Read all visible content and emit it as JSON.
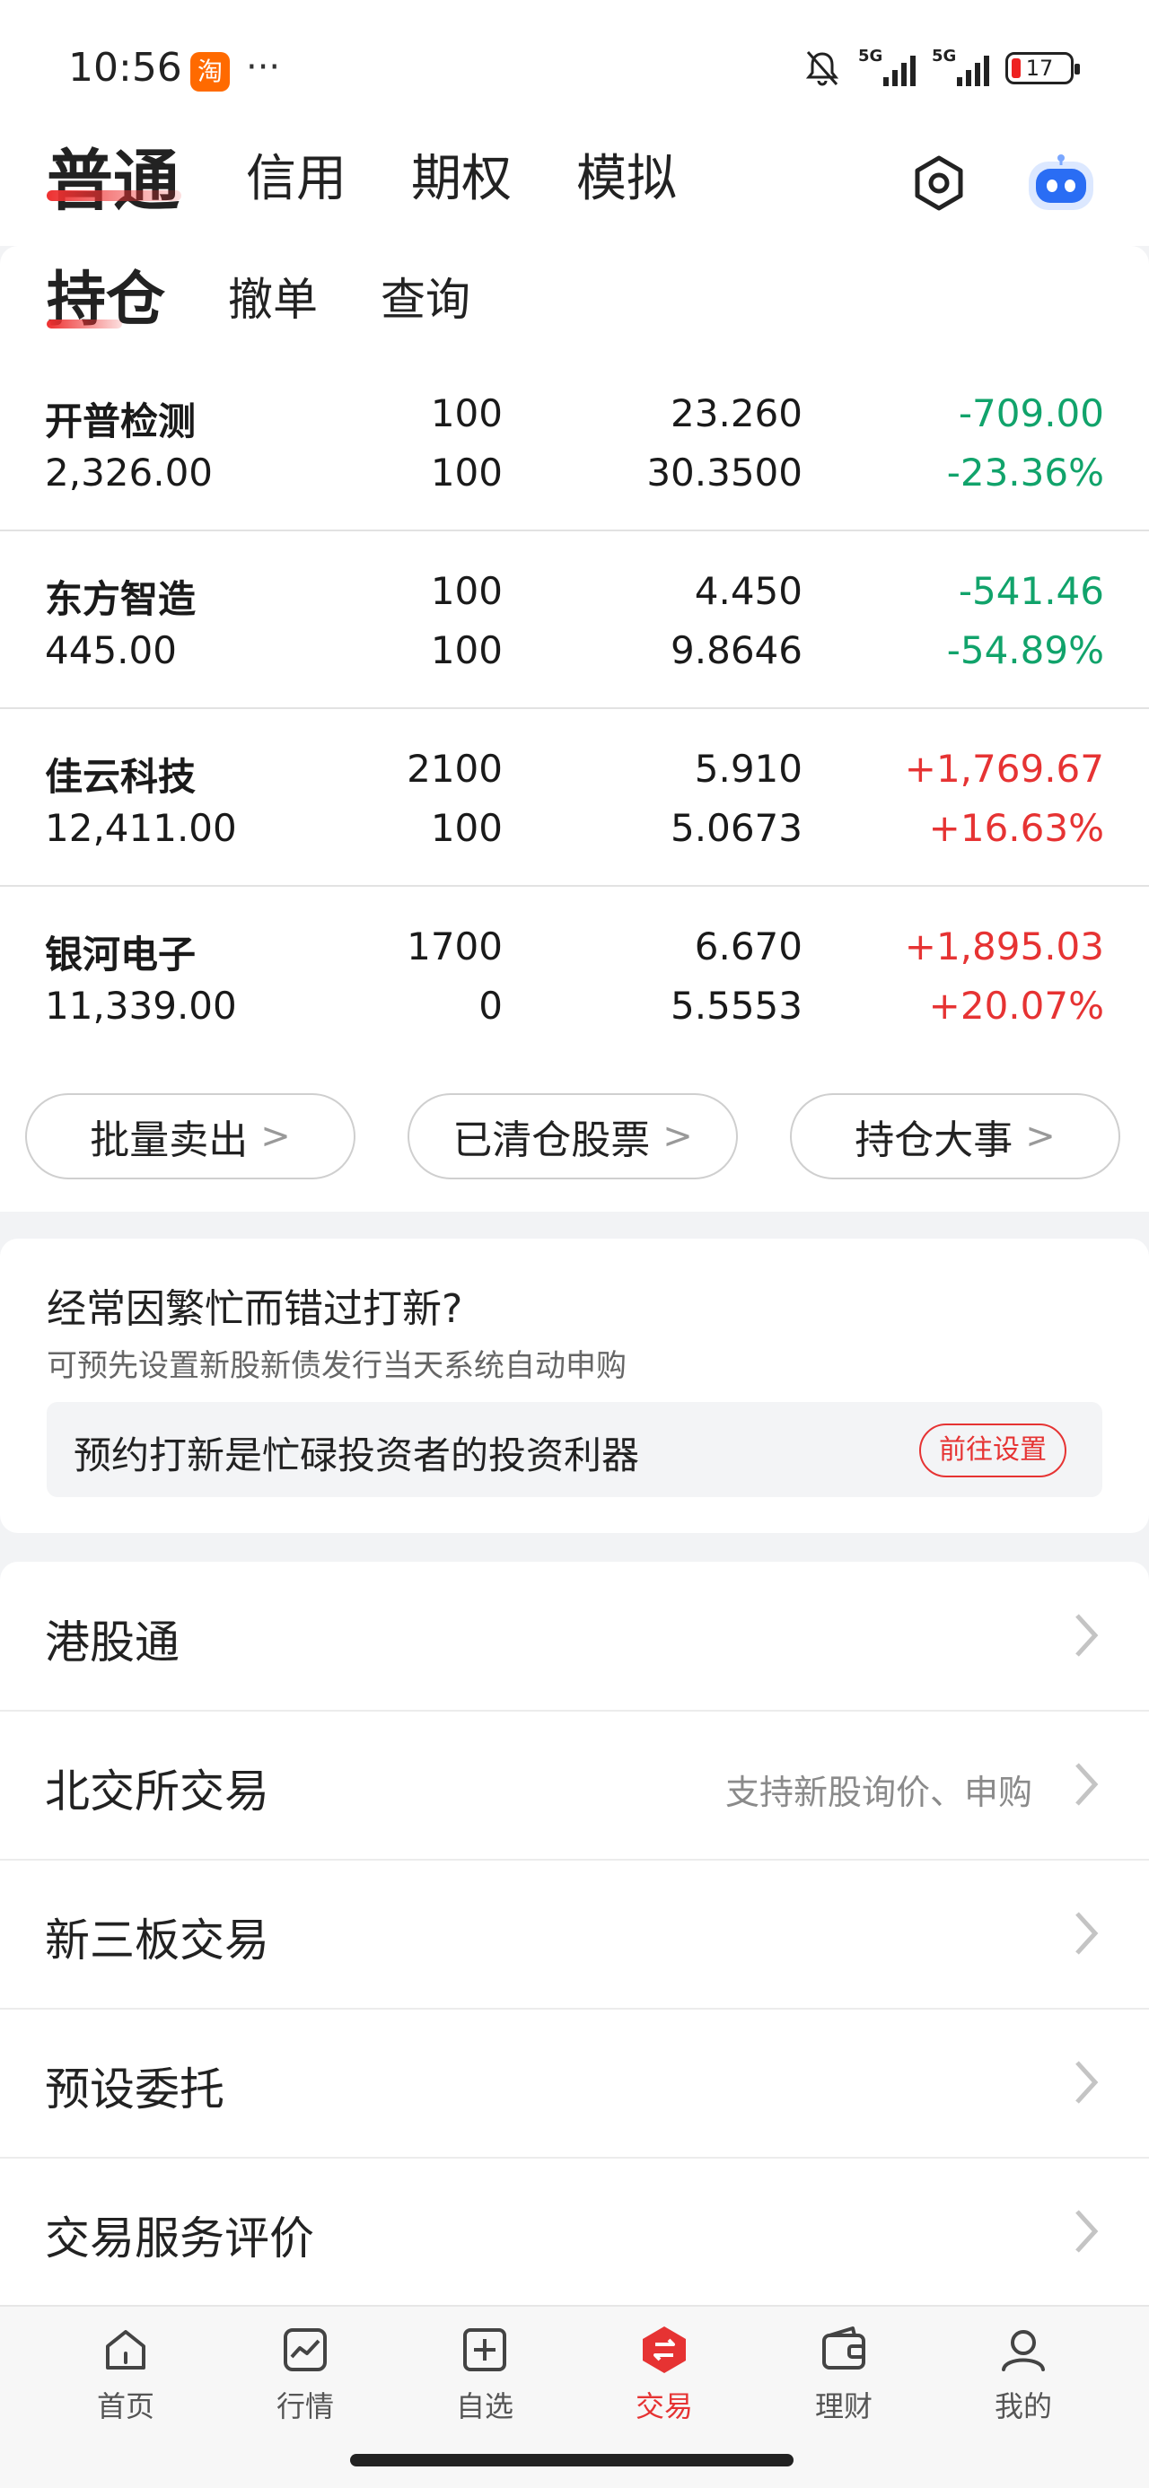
{
  "status_bar": {
    "time": "10:56",
    "app_badge": "淘",
    "more": "···",
    "signal_1": "5G",
    "signal_2": "5G",
    "battery": "17"
  },
  "top_tabs": [
    "普通",
    "信用",
    "期权",
    "模拟"
  ],
  "sub_tabs": [
    "持仓",
    "撤单",
    "查询"
  ],
  "holdings": [
    {
      "name": "开普检测",
      "market_value": "2,326.00",
      "qty": "100",
      "avail": "100",
      "price": "23.260",
      "cost": "30.3500",
      "pl": "-709.00",
      "pl_pct": "-23.36%"
    },
    {
      "name": "东方智造",
      "market_value": "445.00",
      "qty": "100",
      "avail": "100",
      "price": "4.450",
      "cost": "9.8646",
      "pl": "-541.46",
      "pl_pct": "-54.89%"
    },
    {
      "name": "佳云科技",
      "market_value": "12,411.00",
      "qty": "2100",
      "avail": "100",
      "price": "5.910",
      "cost": "5.0673",
      "pl": "+1,769.67",
      "pl_pct": "+16.63%"
    },
    {
      "name": "银河电子",
      "market_value": "11,339.00",
      "qty": "1700",
      "avail": "0",
      "price": "6.670",
      "cost": "5.5553",
      "pl": "+1,895.03",
      "pl_pct": "+20.07%"
    }
  ],
  "actions": [
    "批量卖出",
    "已清仓股票",
    "持仓大事"
  ],
  "ipo": {
    "title": "经常因繁忙而错过打新?",
    "subtitle": "可预先设置新股新债发行当天系统自动申购",
    "box_text": "预约打新是忙碌投资者的投资利器",
    "button": "前往设置"
  },
  "menu": [
    {
      "label": "港股通",
      "hint": ""
    },
    {
      "label": "北交所交易",
      "hint": "支持新股询价、申购"
    },
    {
      "label": "新三板交易",
      "hint": ""
    },
    {
      "label": "预设委托",
      "hint": ""
    },
    {
      "label": "交易服务评价",
      "hint": ""
    }
  ],
  "bottom_nav": [
    "首页",
    "行情",
    "自选",
    "交易",
    "理财",
    "我的"
  ],
  "colors": {
    "accent": "#e63333",
    "gain": "#e63333",
    "loss": "#11a36b"
  }
}
